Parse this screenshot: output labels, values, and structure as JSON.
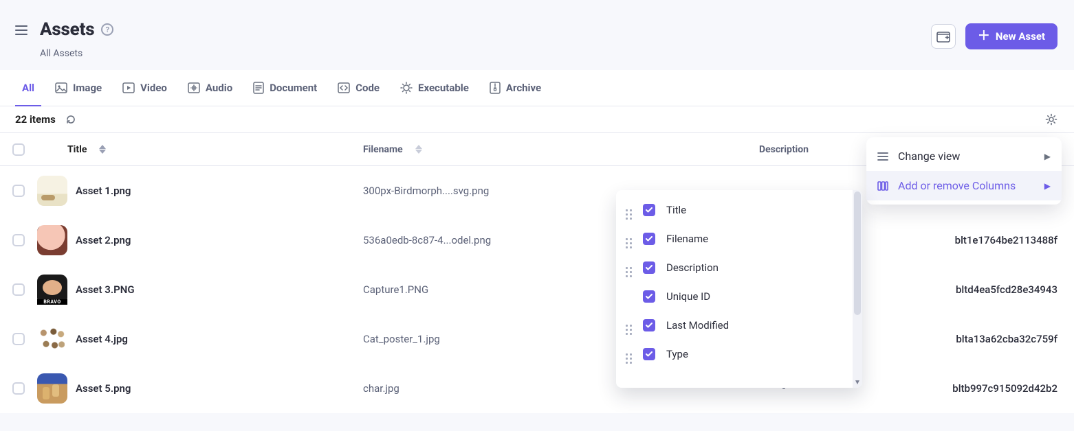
{
  "header": {
    "title": "Assets",
    "subtitle": "All Assets",
    "new_button": "New Asset"
  },
  "tabs": [
    {
      "label": "All"
    },
    {
      "label": "Image"
    },
    {
      "label": "Video"
    },
    {
      "label": "Audio"
    },
    {
      "label": "Document"
    },
    {
      "label": "Code"
    },
    {
      "label": "Executable"
    },
    {
      "label": "Archive"
    }
  ],
  "count": "22 items",
  "columns": {
    "title": "Title",
    "filename": "Filename",
    "description": "Description"
  },
  "rows": [
    {
      "title": "Asset 1.png",
      "filename": "300px-Birdmorph....svg.png",
      "desc": "",
      "uid": ""
    },
    {
      "title": "Asset 2.png",
      "filename": "536a0edb-8c87-4...odel.png",
      "desc": "",
      "uid": "blt1e1764be2113488f"
    },
    {
      "title": "Asset 3.PNG",
      "filename": "Capture1.PNG",
      "desc": "",
      "uid": "bltd4ea5fcd28e34943"
    },
    {
      "title": "Asset 4.jpg",
      "filename": "Cat_poster_1.jpg",
      "desc": "",
      "uid": "blta13a62cba32c759f"
    },
    {
      "title": "Asset 5.png",
      "filename": "char.jpg",
      "desc": "-",
      "uid": "bltb997c915092d42b2"
    }
  ],
  "gear_menu": {
    "change_view": "Change view",
    "add_remove": "Add or remove Columns"
  },
  "columns_popup": [
    "Title",
    "Filename",
    "Description",
    "Unique ID",
    "Last Modified",
    "Type"
  ]
}
